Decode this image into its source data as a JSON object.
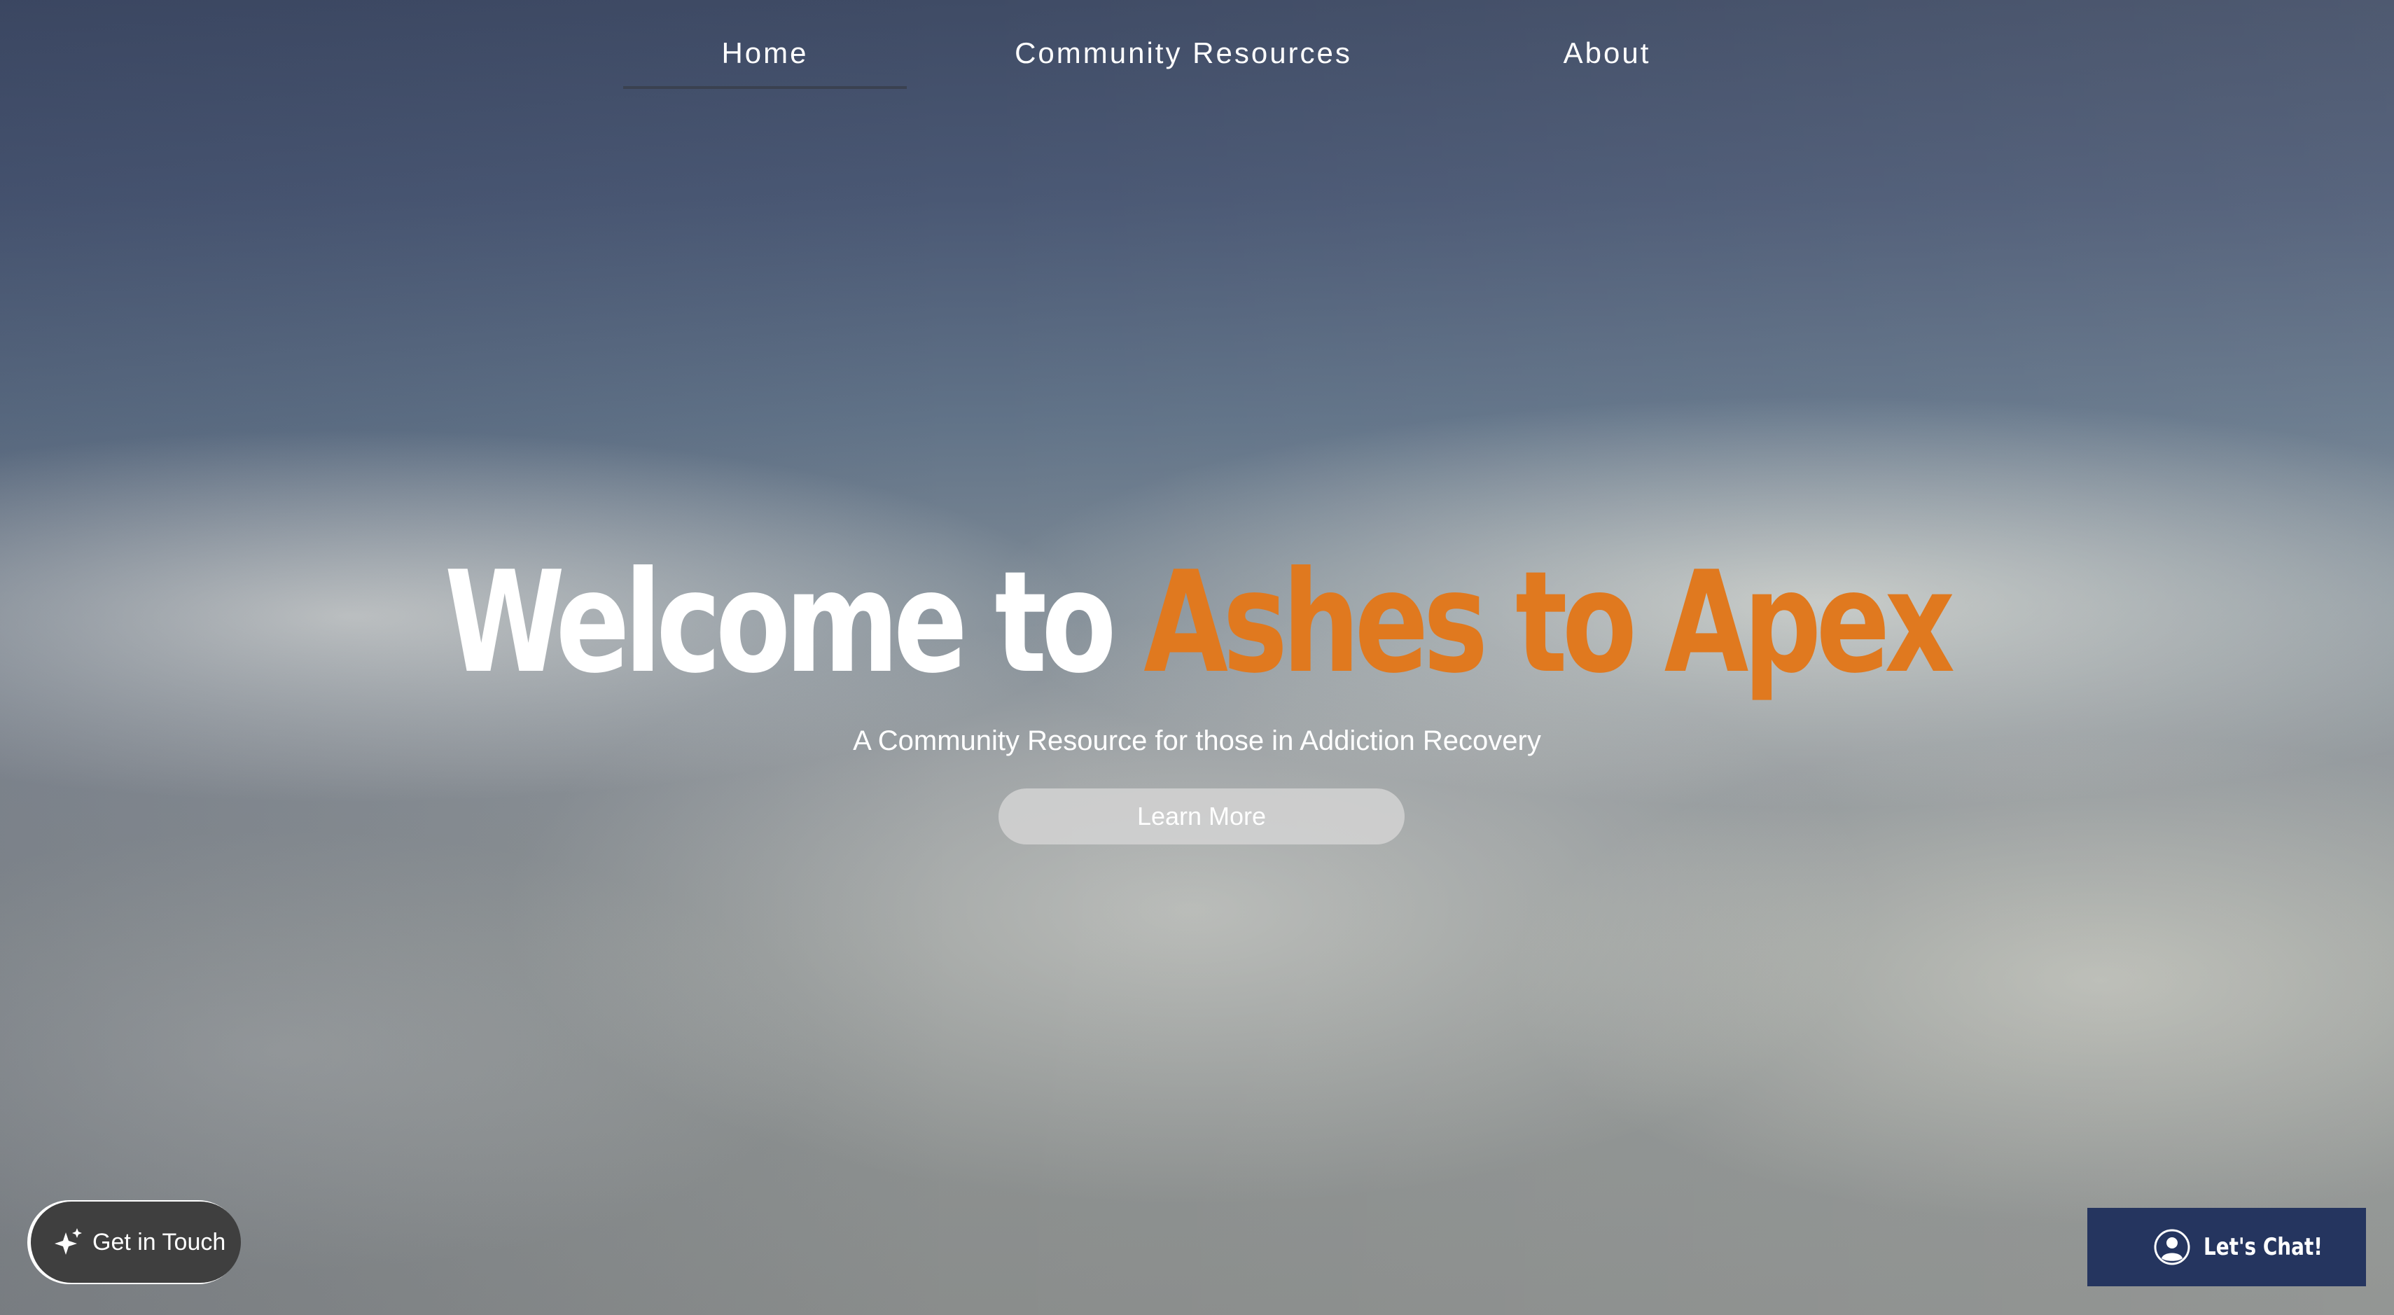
{
  "nav": {
    "items": [
      {
        "label": "Home",
        "active": true
      },
      {
        "label": "Community Resources",
        "active": false
      },
      {
        "label": "About",
        "active": false
      }
    ]
  },
  "hero": {
    "title_prefix": "Welcome to ",
    "title_highlight": "Ashes to Apex",
    "subtitle": "A Community Resource for those in Addiction Recovery",
    "cta_label": "Learn More"
  },
  "widgets": {
    "get_in_touch": {
      "label": "Get in Touch",
      "icon": "sparkle-icon"
    },
    "chat": {
      "label": "Let's Chat!",
      "icon": "user-circle-icon"
    }
  },
  "colors": {
    "accent_orange": "#e0791f",
    "chat_bg": "#25355f",
    "get_in_touch_bg": "#3f3f3f"
  }
}
